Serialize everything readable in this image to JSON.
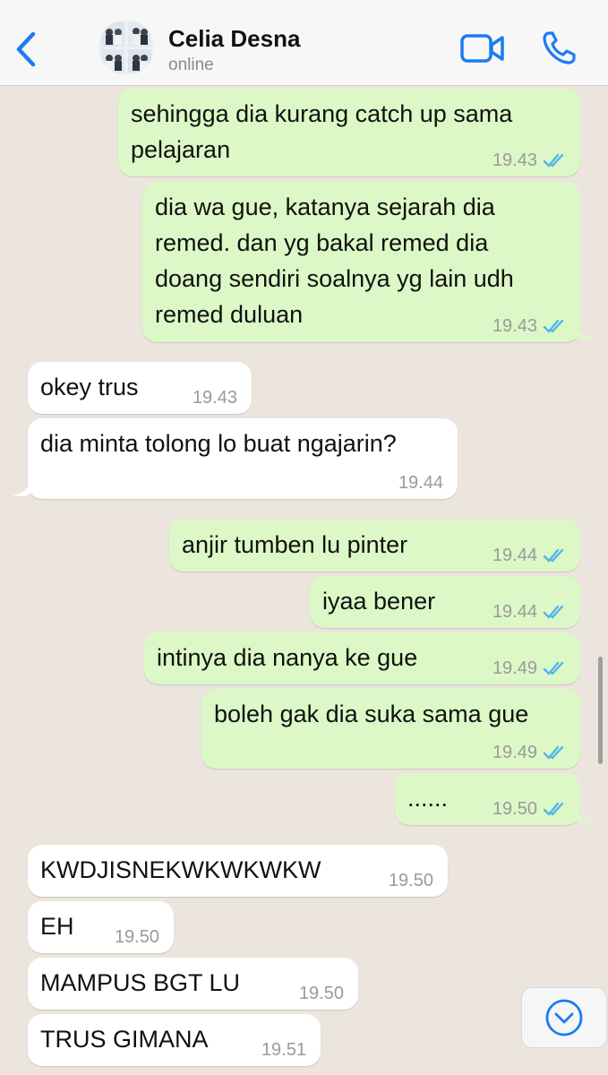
{
  "header": {
    "contact_name": "Celia Desna",
    "status": "online"
  },
  "messages": [
    {
      "id": "m1",
      "direction": "out",
      "lines": [
        "sehingga dia kurang catch up sama",
        "pelajaran"
      ],
      "time": "19.43",
      "read": true
    },
    {
      "id": "m2",
      "direction": "out",
      "lines": [
        "dia wa gue, katanya sejarah dia",
        "remed. dan yg bakal remed dia",
        "doang sendiri soalnya yg lain udh",
        "remed duluan"
      ],
      "time": "19.43",
      "read": true
    },
    {
      "id": "m3",
      "direction": "in",
      "lines": [
        "okey trus"
      ],
      "time": "19.43"
    },
    {
      "id": "m4",
      "direction": "in",
      "lines": [
        "dia minta tolong lo buat ngajarin?"
      ],
      "time": "19.44"
    },
    {
      "id": "m5",
      "direction": "out",
      "lines": [
        "anjir tumben lu pinter"
      ],
      "time": "19.44",
      "read": true
    },
    {
      "id": "m6",
      "direction": "out",
      "lines": [
        "iyaa bener"
      ],
      "time": "19.44",
      "read": true
    },
    {
      "id": "m7",
      "direction": "out",
      "lines": [
        "intinya dia nanya ke gue"
      ],
      "time": "19.49",
      "read": true
    },
    {
      "id": "m8",
      "direction": "out",
      "lines": [
        "boleh gak dia suka sama gue"
      ],
      "time": "19.49",
      "read": true
    },
    {
      "id": "m9",
      "direction": "out",
      "lines": [
        "......"
      ],
      "time": "19.50",
      "read": true
    },
    {
      "id": "m10",
      "direction": "in",
      "lines": [
        "KWDJISNEKWKWKWKW"
      ],
      "time": "19.50"
    },
    {
      "id": "m11",
      "direction": "in",
      "lines": [
        "EH"
      ],
      "time": "19.50"
    },
    {
      "id": "m12",
      "direction": "in",
      "lines": [
        "MAMPUS BGT LU"
      ],
      "time": "19.50"
    },
    {
      "id": "m13",
      "direction": "in",
      "lines": [
        "TRUS GIMANA"
      ],
      "time": "19.51"
    }
  ],
  "icons": {
    "back": "chevron-left-icon",
    "video": "video-camera-icon",
    "call": "phone-icon",
    "read_receipt": "double-check-icon",
    "scroll_down": "chevron-down-circle-icon"
  },
  "colors": {
    "chat_background": "#ECE5DD",
    "outgoing_bubble": "#DCF8C6",
    "incoming_bubble": "#FFFFFF",
    "accent": "#1A7CF2",
    "read_tick": "#4FB6EC",
    "timestamp": "#9A9A9A"
  }
}
